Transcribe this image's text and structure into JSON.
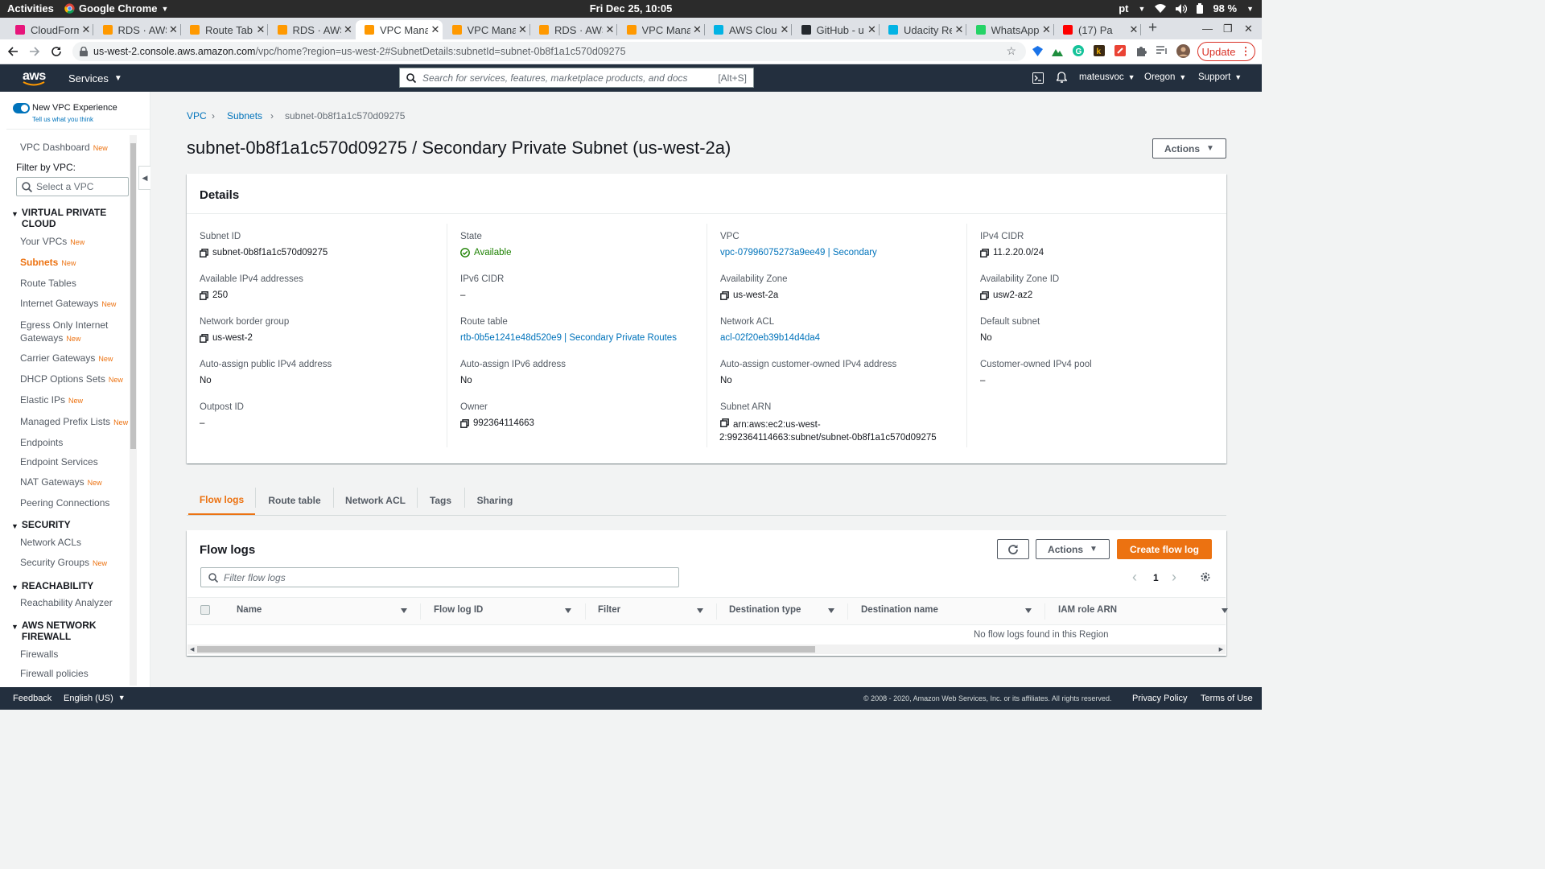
{
  "os": {
    "activities": "Activities",
    "app": "Google Chrome",
    "clock": "Fri Dec 25, 10:05",
    "lang": "pt",
    "battery": "98 %"
  },
  "tabs": [
    {
      "title": "CloudForm",
      "color": "#e7157b"
    },
    {
      "title": "RDS · AWS",
      "color": "#f90"
    },
    {
      "title": "Route Tab",
      "color": "#f90"
    },
    {
      "title": "RDS · AWS",
      "color": "#f90"
    },
    {
      "title": "VPC Mana",
      "color": "#f90"
    },
    {
      "title": "VPC Mana",
      "color": "#f90"
    },
    {
      "title": "RDS · AWS",
      "color": "#f90"
    },
    {
      "title": "VPC Mana",
      "color": "#f90"
    },
    {
      "title": "AWS Cloud",
      "color": "#02b3e4"
    },
    {
      "title": "GitHub - u",
      "color": "#24292e"
    },
    {
      "title": "Udacity Re",
      "color": "#02b3e4"
    },
    {
      "title": "WhatsApp",
      "color": "#25d366"
    },
    {
      "title": "(17) Pa",
      "color": "#f00"
    }
  ],
  "browser": {
    "url_host": "us-west-2.console.aws.amazon.com",
    "url_path": "/vpc/home?region=us-west-2#SubnetDetails:subnetId=subnet-0b8f1a1c570d09275",
    "update": "Update"
  },
  "awsnav": {
    "logo": "aws",
    "services": "Services",
    "search_placeholder": "Search for services, features, marketplace products, and docs",
    "search_kbd": "[Alt+S]",
    "user": "mateusvoc",
    "region": "Oregon",
    "support": "Support"
  },
  "sidenav": {
    "toggle_label": "New VPC Experience",
    "toggle_sub": "Tell us what you think",
    "dashboard": "VPC Dashboard",
    "filter_label": "Filter by VPC:",
    "filter_placeholder": "Select a VPC",
    "new_badge": "New",
    "sec_vpc": "VIRTUAL PRIVATE CLOUD",
    "your_vpcs": "Your VPCs",
    "subnets": "Subnets",
    "route_tables": "Route Tables",
    "igw": "Internet Gateways",
    "egress": "Egress Only Internet Gateways",
    "carrier": "Carrier Gateways",
    "dhcp": "DHCP Options Sets",
    "eip": "Elastic IPs",
    "prefix": "Managed Prefix Lists",
    "endpoints": "Endpoints",
    "endpoint_services": "Endpoint Services",
    "nat": "NAT Gateways",
    "peering": "Peering Connections",
    "sec_security": "SECURITY",
    "nacls": "Network ACLs",
    "sgs": "Security Groups",
    "sec_reach": "REACHABILITY",
    "reach_analyzer": "Reachability Analyzer",
    "sec_fw": "AWS NETWORK FIREWALL",
    "firewalls": "Firewalls",
    "fw_policies": "Firewall policies"
  },
  "breadcrumb": {
    "vpc": "VPC",
    "subnets": "Subnets",
    "current": "subnet-0b8f1a1c570d09275"
  },
  "page_title": "subnet-0b8f1a1c570d09275 / Secondary Private Subnet (us-west-2a)",
  "actions": "Actions",
  "details": {
    "heading": "Details",
    "subnet_id_label": "Subnet ID",
    "subnet_id": "subnet-0b8f1a1c570d09275",
    "state_label": "State",
    "state": "Available",
    "vpc_label": "VPC",
    "vpc": "vpc-07996075273a9ee49 | Secondary",
    "ipv4_cidr_label": "IPv4 CIDR",
    "ipv4_cidr": "11.2.20.0/24",
    "avail_ipv4_label": "Available IPv4 addresses",
    "avail_ipv4": "250",
    "ipv6_cidr_label": "IPv6 CIDR",
    "ipv6_cidr": "–",
    "az_label": "Availability Zone",
    "az": "us-west-2a",
    "az_id_label": "Availability Zone ID",
    "az_id": "usw2-az2",
    "nbg_label": "Network border group",
    "nbg": "us-west-2",
    "route_table_label": "Route table",
    "route_table": "rtb-0b5e1241e48d520e9 | Secondary Private Routes",
    "nacl_label": "Network ACL",
    "nacl": "acl-02f20eb39b14d4da4",
    "default_subnet_label": "Default subnet",
    "default_subnet": "No",
    "auto_pub_ipv4_label": "Auto-assign public IPv4 address",
    "auto_pub_ipv4": "No",
    "auto_ipv6_label": "Auto-assign IPv6 address",
    "auto_ipv6": "No",
    "auto_cust_ipv4_label": "Auto-assign customer-owned IPv4 address",
    "auto_cust_ipv4": "No",
    "cust_pool_label": "Customer-owned IPv4 pool",
    "cust_pool": "–",
    "outpost_label": "Outpost ID",
    "outpost": "–",
    "owner_label": "Owner",
    "owner": "992364114663",
    "arn_label": "Subnet ARN",
    "arn_line1": "arn:aws:ec2:us-west-",
    "arn_line2": "2:992364114663:subnet/subnet-0b8f1a1c570d09275"
  },
  "detail_tabs": [
    "Flow logs",
    "Route table",
    "Network ACL",
    "Tags",
    "Sharing"
  ],
  "flowlogs": {
    "heading": "Flow logs",
    "actions": "Actions",
    "create": "Create flow log",
    "filter_placeholder": "Filter flow logs",
    "page": "1",
    "columns": [
      "Name",
      "Flow log ID",
      "Filter",
      "Destination type",
      "Destination name",
      "IAM role ARN"
    ],
    "empty": "No flow logs found in this Region"
  },
  "footer": {
    "feedback": "Feedback",
    "language": "English (US)",
    "copyright": "© 2008 - 2020, Amazon Web Services, Inc. or its affiliates. All rights reserved.",
    "privacy": "Privacy Policy",
    "terms": "Terms of Use"
  }
}
